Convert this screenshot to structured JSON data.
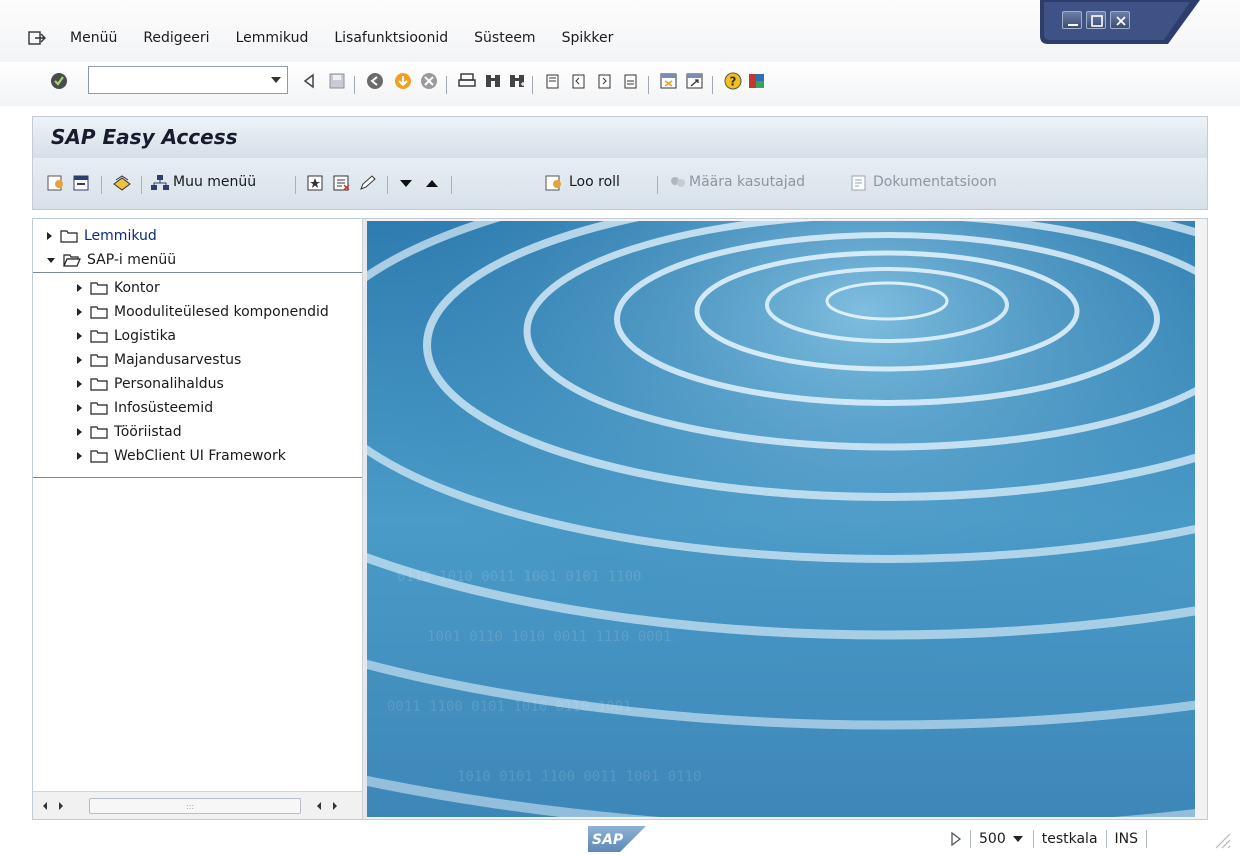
{
  "menubar": {
    "items": [
      {
        "label": "Menüü"
      },
      {
        "label": "Redigeeri"
      },
      {
        "label": "Lemmikud"
      },
      {
        "label": "Lisafunktsioonid"
      },
      {
        "label": "Süsteem"
      },
      {
        "label": "Spikker"
      }
    ]
  },
  "command_field": {
    "value": "",
    "placeholder": ""
  },
  "title": "SAP Easy Access",
  "app_toolbar": {
    "other_menu_label": "Muu menüü",
    "create_role_label": "Loo roll",
    "assign_users_label": "Määra kasutajad",
    "documentation_label": "Dokumentatsioon"
  },
  "tree": {
    "favorites": "Lemmikud",
    "sap_menu": "SAP-i menüü",
    "children": [
      {
        "label": "Kontor"
      },
      {
        "label": "Mooduliteülesed komponendid"
      },
      {
        "label": "Logistika"
      },
      {
        "label": "Majandusarvestus"
      },
      {
        "label": "Personalihaldus"
      },
      {
        "label": "Infosüsteemid"
      },
      {
        "label": "Tööriistad"
      },
      {
        "label": "WebClient UI Framework"
      }
    ]
  },
  "status": {
    "logo_text": "SAP",
    "client": "500",
    "user": "testkala",
    "mode": "INS"
  },
  "colors": {
    "title_bg": "#e3eaf1",
    "toolbar_bg": "#dfe6ee",
    "link_blue": "#0a2a82",
    "window_ctrl_blue": "#2d3d6e"
  }
}
